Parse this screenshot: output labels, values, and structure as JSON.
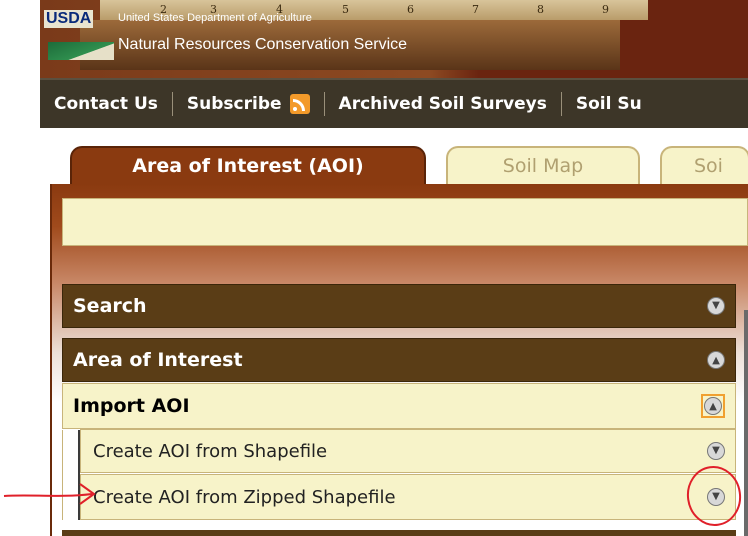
{
  "header": {
    "logo_text": "USDA",
    "department": "United States Department of Agriculture",
    "agency": "Natural Resources Conservation Service",
    "ruler_numbers": [
      "2",
      "3",
      "4",
      "5",
      "6",
      "7",
      "8",
      "9"
    ]
  },
  "nav": {
    "items": [
      {
        "label": "Contact Us"
      },
      {
        "label": "Subscribe",
        "icon": "rss-icon"
      },
      {
        "label": "Archived Soil Surveys"
      },
      {
        "label": "Soil Su"
      }
    ]
  },
  "tabs": [
    {
      "label": "Area of Interest (AOI)",
      "active": true
    },
    {
      "label": "Soil Map",
      "active": false
    },
    {
      "label": "Soi",
      "active": false
    }
  ],
  "panels": {
    "search": {
      "label": "Search",
      "icon": "expand-chevron-icon"
    },
    "area_of_interest": {
      "label": "Area of Interest",
      "icon": "collapse-chevron-icon"
    },
    "import_aoi": {
      "label": "Import AOI",
      "icon": "collapse-chevron-icon"
    },
    "create_shapefile": {
      "label": "Create AOI from Shapefile",
      "icon": "expand-chevron-icon"
    },
    "create_zipped": {
      "label": "Create AOI from Zipped Shapefile",
      "icon": "expand-chevron-icon"
    }
  },
  "annotations": {
    "arrow_color": "#e0202a",
    "circle_color": "#e0202a"
  },
  "colors": {
    "header_brown": "#8a3a10",
    "nav_dark": "#3d3628",
    "bar_dark": "#5a3d16",
    "bar_light": "#f7f3c9"
  }
}
